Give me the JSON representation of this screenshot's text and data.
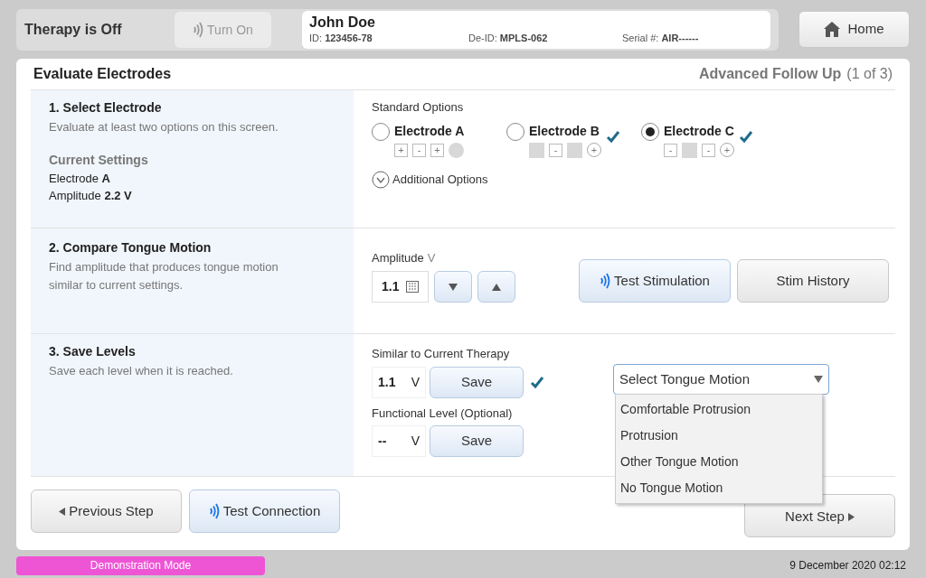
{
  "top_bar": {
    "therapy_status": "Therapy is Off",
    "turn_on_button": {
      "label": "Turn On",
      "disabled": true
    },
    "patient": {
      "name": "John Doe",
      "fields": [
        {
          "label": "ID:",
          "value": "123456-78"
        },
        {
          "label": "De-ID:",
          "value": "MPLS-062"
        },
        {
          "label": "Serial #:",
          "value": "AIR------"
        }
      ]
    },
    "home_button": "Home"
  },
  "header": {
    "title": "Evaluate Electrodes",
    "flow": "Advanced Follow Up",
    "step": "(1 of 3)"
  },
  "section_1": {
    "title": "1. Select Electrode",
    "hint": "Evaluate at least two options on this screen.",
    "current_settings_title": "Current Settings",
    "current_settings": [
      "Electrode **A**",
      "Amplitude **2.2 V**"
    ],
    "options_title": "Standard Options",
    "options": [
      {
        "label": "Electrode A",
        "selected": false,
        "evaluated": false,
        "contacts": [
          {
            "kind": "plus",
            "label": "+"
          },
          {
            "kind": "minus",
            "label": "-"
          },
          {
            "kind": "plus",
            "label": "+"
          },
          {
            "kind": "case-off"
          }
        ]
      },
      {
        "label": "Electrode B",
        "selected": false,
        "evaluated": true,
        "contacts": [
          {
            "kind": "off"
          },
          {
            "kind": "minus",
            "label": "-"
          },
          {
            "kind": "off"
          },
          {
            "kind": "case-plus",
            "label": "+"
          }
        ]
      },
      {
        "label": "Electrode C",
        "selected": true,
        "evaluated": true,
        "contacts": [
          {
            "kind": "minus",
            "label": "-"
          },
          {
            "kind": "off"
          },
          {
            "kind": "minus",
            "label": "-"
          },
          {
            "kind": "case-plus",
            "label": "+"
          }
        ]
      }
    ],
    "additional_options": {
      "label": "Additional Options",
      "expanded": false
    }
  },
  "section_2": {
    "title": "2. Compare Tongue Motion",
    "hint": "Find amplitude that produces tongue motion similar to current settings.",
    "amplitude_label": "Amplitude",
    "amplitude_unit": "V",
    "amplitude_value": "1.1",
    "test_button": "Test Stimulation",
    "history_button": "Stim History"
  },
  "section_3": {
    "title": "3. Save Levels",
    "hint": "Save each level when it is reached.",
    "levels": [
      {
        "label": "Similar to Current Therapy",
        "value": "1.1",
        "unit": "V",
        "button": "Save",
        "saved": true
      },
      {
        "label": "Functional Level (Optional)",
        "value": "--",
        "unit": "V",
        "button": "Save",
        "saved": false
      }
    ],
    "dropdown": {
      "value": "Select Tongue Motion",
      "expanded": true,
      "options": [
        "Comfortable Protrusion",
        "Protrusion",
        "Other Tongue Motion",
        "No Tongue Motion"
      ]
    }
  },
  "footer": {
    "previous": "Previous Step",
    "test_connection": "Test Connection",
    "next": "Next Step"
  },
  "status_bar": {
    "mode": "Demonstration Mode",
    "datetime": "9 December 2020 02:12"
  }
}
